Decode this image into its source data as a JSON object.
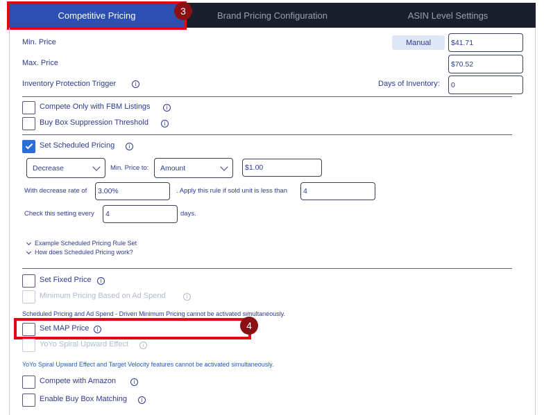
{
  "tabs": [
    {
      "label": "Competitive Pricing",
      "active": true
    },
    {
      "label": "Brand Pricing Configuration",
      "active": false
    },
    {
      "label": "ASIN Level Settings",
      "active": false
    }
  ],
  "callouts": {
    "tab_badge": "3",
    "map_badge": "4"
  },
  "min_price": {
    "label": "Min. Price",
    "mode_label": "Manual",
    "value": "$41.71"
  },
  "max_price": {
    "label": "Max. Price",
    "value": "$70.52"
  },
  "inventory_trigger": {
    "label": "Inventory Protection Trigger",
    "days_label": "Days of Inventory:",
    "days_value": "0"
  },
  "options_top": [
    {
      "label": "Compete Only with FBM Listings",
      "checked": false
    },
    {
      "label": "Buy Box Suppression Threshold",
      "checked": false
    }
  ],
  "scheduled": {
    "label": "Set Scheduled Pricing",
    "checked": true,
    "direction": "Decrease",
    "min_price_to_label": "Min. Price to:",
    "amount_type": "Amount",
    "amount_value": "$1.00",
    "rate_label": "With decrease rate of",
    "rate_value": "3.00%",
    "apply_label": ". Apply this rule if sold unit is less than",
    "sold_value": "4",
    "check_label": "Check this setting every",
    "check_value": "4",
    "days_label": "days.",
    "help_links": [
      "Example Scheduled Pricing Rule Set",
      "How does Scheduled Pricing work?"
    ]
  },
  "fixed_price": {
    "label": "Set Fixed Price"
  },
  "min_pricing_ad_spend": {
    "label": "Minimum Pricing Based on Ad Spend"
  },
  "note_ad_spend": "Scheduled Pricing and Ad Spend - Driven Minimum Pricing cannot be activated simultaneously.",
  "map_price": {
    "label": "Set MAP Price"
  },
  "yoyo": {
    "label": "YoYo Spiral Upward Effect"
  },
  "note_yoyo": "YoYo Spiral Upward Effect and Target Velocity features cannot be activated simultaneously.",
  "compete_amazon": {
    "label": "Compete with Amazon"
  },
  "buy_box_matching": {
    "label": "Enable Buy Box Matching"
  },
  "icons": {
    "info": "i"
  }
}
